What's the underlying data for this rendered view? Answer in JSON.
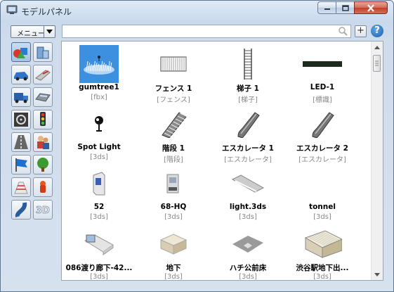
{
  "window": {
    "title": "モデルパネル",
    "controls": {
      "minimize": "minimize",
      "maximize": "maximize",
      "close": "close"
    }
  },
  "toolbar": {
    "menu_label": "メニュー",
    "search_value": "",
    "search_placeholder": "",
    "add_label": "+",
    "help_label": "?"
  },
  "categories": [
    {
      "icon": "shapes-icon",
      "selected": true
    },
    {
      "icon": "building-icon"
    },
    {
      "icon": "car-icon"
    },
    {
      "icon": "train-icon"
    },
    {
      "icon": "truck-icon"
    },
    {
      "icon": "bus-icon"
    },
    {
      "icon": "steering-wheel-icon"
    },
    {
      "icon": "traffic-light-icon"
    },
    {
      "icon": "road-icon"
    },
    {
      "icon": "people-icon"
    },
    {
      "icon": "flag-icon"
    },
    {
      "icon": "tree-icon"
    },
    {
      "icon": "crosswalk-icon"
    },
    {
      "icon": "fire-hydrant-icon"
    },
    {
      "icon": "curve-icon"
    },
    {
      "icon": "3d-text-icon",
      "label": "3D"
    }
  ],
  "models": [
    {
      "name": "gumtree1",
      "type": "[fbx]",
      "icon": "grass-icon",
      "selected": true
    },
    {
      "name": "フェンス 1",
      "type": "[フェンス]",
      "icon": "fence-icon"
    },
    {
      "name": "梯子 1",
      "type": "[梯子]",
      "icon": "ladder-icon"
    },
    {
      "name": "LED-1",
      "type": "[標識]",
      "icon": "led-bar-icon"
    },
    {
      "name": "Spot Light",
      "type": "[3ds]",
      "icon": "spotlight-icon"
    },
    {
      "name": "階段 1",
      "type": "[階段]",
      "icon": "stairs-icon"
    },
    {
      "name": "エスカレータ 1",
      "type": "[エスカレータ]",
      "icon": "escalator-icon"
    },
    {
      "name": "エスカレータ 2",
      "type": "[エスカレータ]",
      "icon": "escalator-icon"
    },
    {
      "name": "52",
      "type": "[3ds]",
      "icon": "vending-machine-icon"
    },
    {
      "name": "68-HQ",
      "type": "[3ds]",
      "icon": "machine-icon"
    },
    {
      "name": "light.3ds",
      "type": "[3ds]",
      "icon": "light-fixture-icon"
    },
    {
      "name": "tonnel",
      "type": "[3ds]",
      "icon": "blank-icon"
    },
    {
      "name": "086渡り廊下-42...",
      "type": "[3ds]",
      "icon": "corridor-icon"
    },
    {
      "name": "地下",
      "type": "[3ds]",
      "icon": "box-icon"
    },
    {
      "name": "ハチ公前床",
      "type": "[3ds]",
      "icon": "floor-tile-icon"
    },
    {
      "name": "渋谷駅地下出...",
      "type": "[3ds]",
      "icon": "building-block-icon"
    }
  ],
  "colors": {
    "selection": "#3d8fe0",
    "close_button": "#c2402a"
  }
}
